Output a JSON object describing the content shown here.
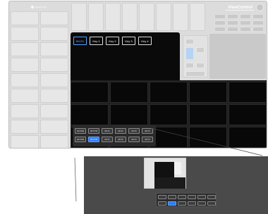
{
  "app": {
    "top_left_label": "ViewControl",
    "brand": "ViewControl"
  },
  "keybar": [
    {
      "label": "BKGD",
      "active": true
    },
    {
      "label": "Key 1",
      "active": false
    },
    {
      "label": "Key 2",
      "active": false
    },
    {
      "label": "Key 3",
      "active": false
    },
    {
      "label": "Key 4",
      "active": false
    }
  ],
  "sources": {
    "row1": [
      "HD PGM",
      "HD PVW",
      "HD 01",
      "HD 02",
      "HD 03",
      "HD 04"
    ],
    "row2": [
      "HD PGM",
      "HD PVW",
      "HD 01",
      "HD 02",
      "HD 03",
      "HD 04"
    ],
    "active_row": 1,
    "active_index": 1
  },
  "colors": {
    "accent": "#2e7bff",
    "key_active": "#5aa0ff",
    "dark_area": "#0a0a0a",
    "dimmed_bg": "#dcdcdc",
    "zoom_bg": "#4a4a4a"
  },
  "icons": {
    "settings": "gear-icon"
  }
}
